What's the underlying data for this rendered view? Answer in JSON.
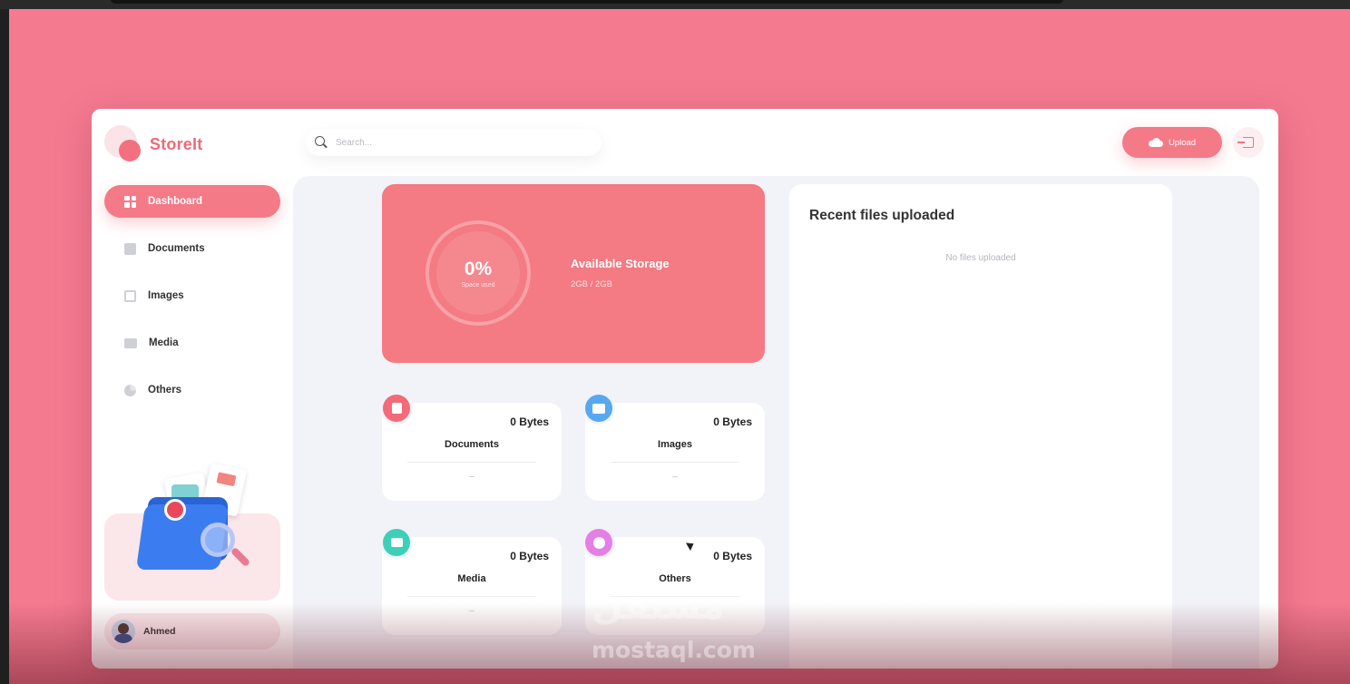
{
  "brand": {
    "name": "StoreIt"
  },
  "search": {
    "placeholder": "Search..."
  },
  "header": {
    "upload_label": "Upload"
  },
  "sidebar": {
    "items": [
      {
        "label": "Dashboard",
        "icon": "grid-icon"
      },
      {
        "label": "Documents",
        "icon": "document-icon"
      },
      {
        "label": "Images",
        "icon": "image-icon"
      },
      {
        "label": "Media",
        "icon": "video-icon"
      },
      {
        "label": "Others",
        "icon": "pie-chart-icon"
      }
    ],
    "user": {
      "name": "Ahmed"
    }
  },
  "storage": {
    "percent": "0%",
    "percent_label": "Space used",
    "title": "Available Storage",
    "usage": "2GB / 2GB"
  },
  "categories": [
    {
      "title": "Documents",
      "size": "0 Bytes",
      "meta": "–",
      "color": "#f36a79"
    },
    {
      "title": "Images",
      "size": "0 Bytes",
      "meta": "–",
      "color": "#57a8f1"
    },
    {
      "title": "Media",
      "size": "0 Bytes",
      "meta": "–",
      "color": "#3dd0b8"
    },
    {
      "title": "Others",
      "size": "0 Bytes",
      "meta": "",
      "color": "#e57fe8"
    }
  ],
  "recent": {
    "title": "Recent files uploaded",
    "empty": "No files uploaded"
  },
  "watermark": {
    "arabic": "مستقل",
    "latin": "mostaql.com"
  },
  "colors": {
    "accent": "#f47a88",
    "background": "#f47a90"
  }
}
